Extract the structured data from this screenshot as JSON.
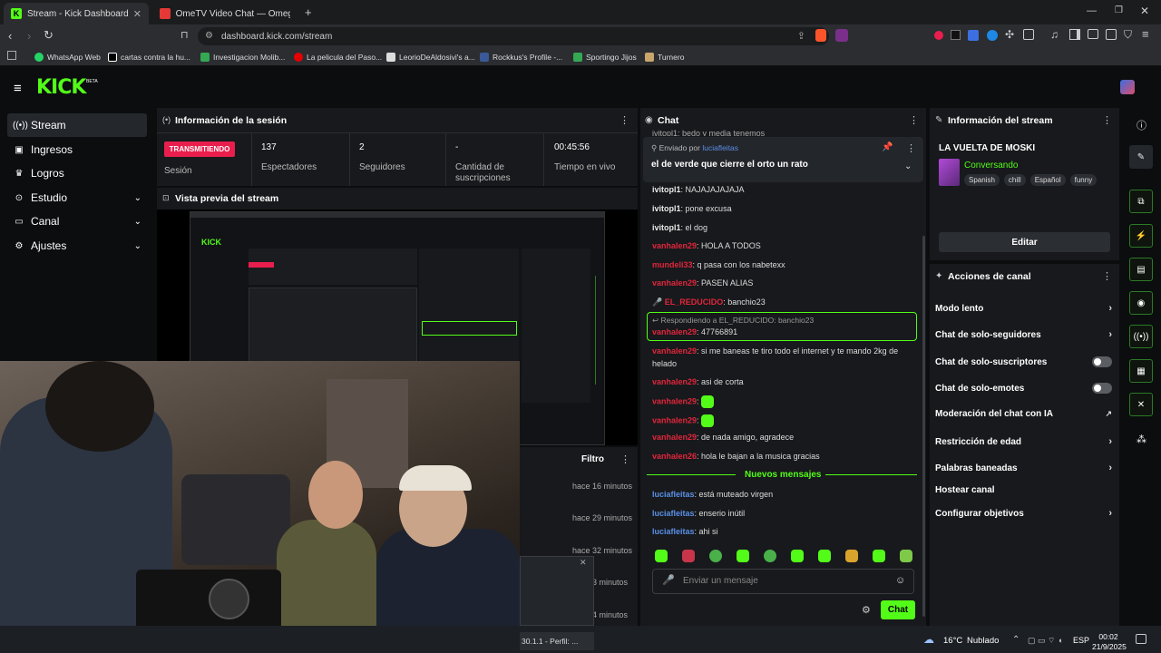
{
  "browser": {
    "tabs": [
      {
        "label": "Stream - Kick Dashboard"
      },
      {
        "label": "OmeTV Video Chat — Omegle Rand"
      }
    ],
    "url": "dashboard.kick.com/stream",
    "bookmarks": [
      "WhatsApp Web",
      "cartas contra la hu...",
      "Investigacion Molib...",
      "La pelicula del Paso...",
      "LeorioDeAldosivi's a...",
      "Rockkus's Profile -...",
      "Sportingo Jijos",
      "Turnero"
    ]
  },
  "logo": {
    "text": "KICK",
    "badge": "BETA"
  },
  "sidebar": {
    "items": [
      {
        "label": "Stream",
        "icon": "broadcast-icon"
      },
      {
        "label": "Ingresos",
        "icon": "money-icon"
      },
      {
        "label": "Logros",
        "icon": "trophy-icon"
      },
      {
        "label": "Estudio",
        "icon": "studio-icon"
      },
      {
        "label": "Canal",
        "icon": "channel-icon"
      },
      {
        "label": "Ajustes",
        "icon": "gear-icon"
      }
    ]
  },
  "session": {
    "title": "Información de la sesión",
    "live_badge": "TRANSMITIENDO",
    "session_label": "Sesión",
    "viewers": "137",
    "viewers_label": "Espectadores",
    "followers": "2",
    "followers_label": "Seguidores",
    "subs": "-",
    "subs_label": "Cantidad de suscripciones",
    "time": "00:45:56",
    "time_label": "Tiempo en vivo"
  },
  "preview": {
    "title": "Vista previa del stream"
  },
  "activity": {
    "filter": "Filtro",
    "times": [
      "hace 16 minutos",
      "hace 29 minutos",
      "hace 32 minutos",
      "3 minutos",
      "4 minutos"
    ]
  },
  "chat": {
    "title": "Chat",
    "top_line": "ivitopl1: bedo y media tenemos",
    "pinned_by_prefix": "Enviado por",
    "pinned_by": "luciafleitas",
    "pinned_msg": "el de verde que cierre el orto un rato",
    "lines": [
      {
        "user": "ivitopl1",
        "msg": "NAJAJAJAJAJA"
      },
      {
        "user": "ivitopl1",
        "msg": "pone excusa"
      },
      {
        "user": "ivitopl1",
        "msg": "el dog"
      },
      {
        "user": "vanhalen29",
        "msg": "HOLA A TODOS"
      },
      {
        "user": "mundeli33",
        "msg": "q pasa con los nabetexx"
      },
      {
        "user": "vanhalen29",
        "msg": "PASEN ALIAS"
      },
      {
        "user": "EL_REDUCIDO",
        "msg": "banchio23"
      }
    ],
    "reply_to": "Respondiendo a EL_REDUCIDO: banchio23",
    "reply_user": "vanhalen29",
    "reply_msg": "47766891",
    "lines2": [
      {
        "user": "vanhalen29",
        "msg": "si me baneas te tiro todo el internet y te mando 2kg de"
      },
      {
        "user": "",
        "msg": "helado"
      },
      {
        "user": "vanhalen29",
        "msg": "asi de corta"
      },
      {
        "user": "vanhalen29",
        "msg": ""
      },
      {
        "user": "vanhalen29",
        "msg": ""
      },
      {
        "user": "vanhalen29",
        "msg": "de nada amigo, agradece"
      },
      {
        "user": "vanhalen26",
        "msg": "hola le bajan a la musica gracias"
      }
    ],
    "new_messages": "Nuevos mensajes",
    "lines3": [
      {
        "user": "luciafleitas",
        "msg": "está muteado virgen"
      },
      {
        "user": "luciafleitas",
        "msg": "enserio inútil"
      },
      {
        "user": "luciafleitas",
        "msg": "ahi si"
      }
    ],
    "placeholder": "Enviar un mensaje",
    "send": "Chat"
  },
  "stream_info": {
    "title": "Información del stream",
    "stream_title": "LA VUELTA DE MOSKI",
    "category": "Conversando",
    "tags": [
      "Spanish",
      "chill",
      "Español",
      "funny"
    ],
    "edit": "Editar"
  },
  "actions": {
    "title": "Acciones de canal",
    "items": [
      {
        "label": "Modo lento",
        "kind": "arrow"
      },
      {
        "label": "Chat de solo-seguidores",
        "kind": "arrow"
      },
      {
        "label": "Chat de solo-suscriptores",
        "kind": "toggle"
      },
      {
        "label": "Chat de solo-emotes",
        "kind": "toggle"
      },
      {
        "label": "Moderación del chat con IA",
        "kind": "ext"
      },
      {
        "label": "Restricción de edad",
        "kind": "arrow"
      },
      {
        "label": "Palabras baneadas",
        "kind": "arrow"
      },
      {
        "label": "Hostear canal",
        "kind": "none"
      },
      {
        "label": "Configurar objetivos",
        "kind": "arrow"
      }
    ]
  },
  "taskbar": {
    "task_label": "30.1.1 - Perfil: ...",
    "weather": "16°C",
    "weather_desc": "Nublado",
    "lang": "ESP",
    "time": "00:02",
    "date": "21/9/2025"
  },
  "colors": {
    "kick_green": "#53fc18",
    "live_red": "#e91e4d",
    "user_red": "#e0263c",
    "user_blue": "#5b8fe6"
  }
}
